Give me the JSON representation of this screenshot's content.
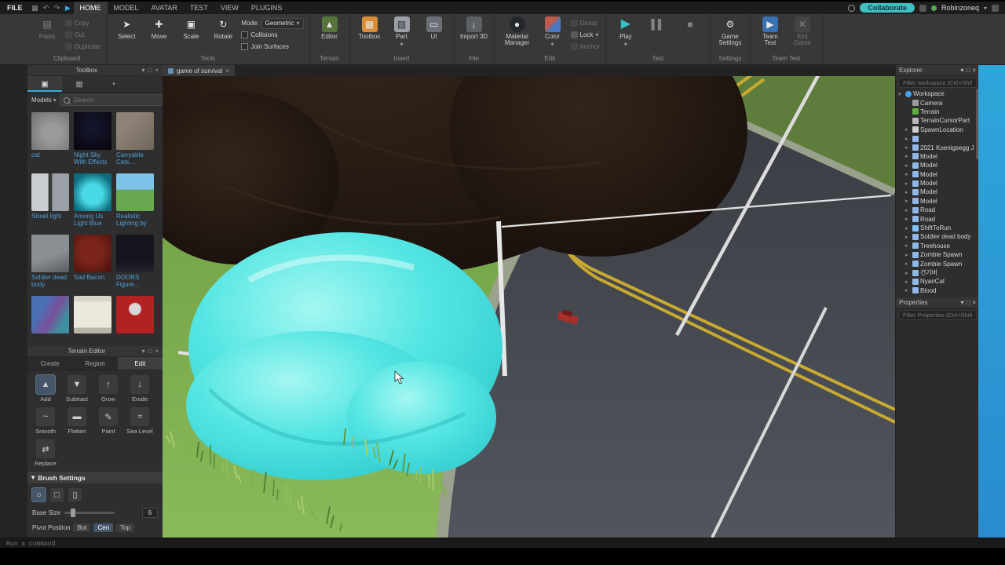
{
  "titlebar": {
    "file": "FILE",
    "tabs": [
      "HOME",
      "MODEL",
      "AVATAR",
      "TEST",
      "VIEW",
      "PLUGINS"
    ],
    "active_tab": "HOME",
    "collaborate": "Collaborate",
    "user": "Robinzoneq"
  },
  "ribbon": {
    "clipboard": {
      "label": "Clipboard",
      "paste": "Paste",
      "copy": "Copy",
      "cut": "Cut",
      "duplicate": "Duplicate"
    },
    "tools": {
      "label": "Tools",
      "select": "Select",
      "move": "Move",
      "scale": "Scale",
      "rotate": "Rotate",
      "mode_label": "Mode:",
      "mode_value": "Geometric",
      "collisions": "Collisions",
      "join_surfaces": "Join Surfaces"
    },
    "terrain": {
      "label": "Terrain",
      "editor": "Editor"
    },
    "insert": {
      "label": "Insert",
      "toolbox": "Toolbox",
      "part": "Part",
      "ui": "UI"
    },
    "file": {
      "label": "File",
      "import3d": "Import 3D"
    },
    "edit": {
      "label": "Edit",
      "material_manager": "Material Manager",
      "color": "Color",
      "group": "Group",
      "lock": "Lock",
      "anchor": "Anchor"
    },
    "test": {
      "label": "Test",
      "play": "Play"
    },
    "settings": {
      "label": "Settings",
      "game_settings": "Game Settings"
    },
    "team_test": {
      "label": "Team Test",
      "team_test": "Team Test",
      "exit": "Exit Game"
    }
  },
  "toolbox": {
    "title": "Toolbox",
    "models_label": "Models",
    "search_placeholder": "Search",
    "items": [
      {
        "label": "cat"
      },
      {
        "label": "Night Sky With Effects"
      },
      {
        "label": "Carryable Cats…"
      },
      {
        "label": "Street light"
      },
      {
        "label": "Among Us Light Blue"
      },
      {
        "label": "Realistic Lighting by"
      },
      {
        "label": "Soldier dead body"
      },
      {
        "label": "Sad Bacon"
      },
      {
        "label": "DOORS Figure…"
      },
      {
        "label": ""
      },
      {
        "label": ""
      },
      {
        "label": ""
      }
    ]
  },
  "terrain": {
    "title": "Terrain Editor",
    "tabs": [
      "Create",
      "Region",
      "Edit"
    ],
    "active_tab": "Edit",
    "tools": [
      "Add",
      "Subtract",
      "Grow",
      "Erode",
      "Smooth",
      "Flatten",
      "Paint",
      "Sea Level",
      "Replace"
    ],
    "selected_tool": "Add",
    "brush_settings": "Brush Settings",
    "base_size_label": "Base Size",
    "base_size_value": "6",
    "pivot_label": "Pivot Position",
    "pivot_options": [
      "Bot",
      "Cen",
      "Top"
    ],
    "pivot_selected": "Cen"
  },
  "viewport": {
    "tab": "game of survival"
  },
  "explorer": {
    "title": "Explorer",
    "filter_placeholder": "Filter workspace (Ctrl+Shift…",
    "items": [
      {
        "label": "Workspace"
      },
      {
        "label": "Camera"
      },
      {
        "label": "Terrain"
      },
      {
        "label": "TerrainCursorPart"
      },
      {
        "label": "SpawnLocation"
      },
      {
        "label": ""
      },
      {
        "label": "2021 Koenigsegg J"
      },
      {
        "label": "Model"
      },
      {
        "label": "Model"
      },
      {
        "label": "Model"
      },
      {
        "label": "Model"
      },
      {
        "label": "Model"
      },
      {
        "label": "Model"
      },
      {
        "label": "Road"
      },
      {
        "label": "Road"
      },
      {
        "label": "ShiftToRun"
      },
      {
        "label": "Soldier dead body"
      },
      {
        "label": "Treehouse"
      },
      {
        "label": "Zombie Spawn"
      },
      {
        "label": "Zombie Spawn"
      },
      {
        "label": "건기버"
      },
      {
        "label": "NyanCat"
      },
      {
        "label": "Blood"
      }
    ]
  },
  "properties": {
    "title": "Properties",
    "filter_placeholder": "Filter Properties (Ctrl+Shift…"
  },
  "command_bar": {
    "placeholder": "Run a command"
  },
  "colors": {
    "accent_teal": "#3fc1c4",
    "selection_blue": "#35a9e0",
    "terrain_cyan": "#55e6e3"
  }
}
